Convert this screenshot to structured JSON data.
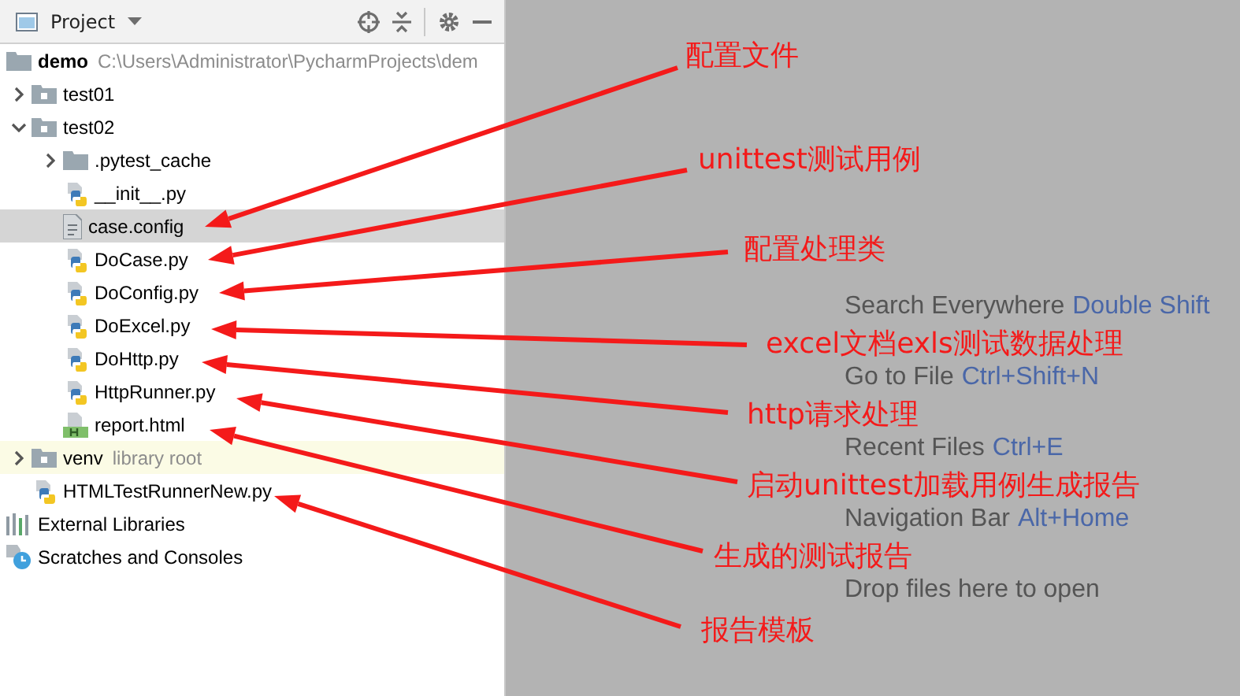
{
  "panel": {
    "title": "Project"
  },
  "tree": [
    {
      "label": "demo",
      "kind": "root",
      "path": "C:\\Users\\Administrator\\PycharmProjects\\dem",
      "selected": false,
      "children": [
        {
          "label": "test01",
          "kind": "module-folder",
          "selected": false,
          "expanded": false
        },
        {
          "label": "test02",
          "kind": "module-folder",
          "selected": false,
          "expanded": true,
          "children": [
            {
              "label": ".pytest_cache",
              "kind": "folder",
              "selected": false,
              "expanded": false
            },
            {
              "label": "__init__.py",
              "kind": "python",
              "selected": false
            },
            {
              "label": "case.config",
              "kind": "text-file",
              "selected": true
            },
            {
              "label": "DoCase.py",
              "kind": "python",
              "selected": false
            },
            {
              "label": "DoConfig.py",
              "kind": "python",
              "selected": false
            },
            {
              "label": "DoExcel.py",
              "kind": "python",
              "selected": false
            },
            {
              "label": "DoHttp.py",
              "kind": "python",
              "selected": false
            },
            {
              "label": "HttpRunner.py",
              "kind": "python",
              "selected": false
            },
            {
              "label": "report.html",
              "kind": "html",
              "selected": false
            }
          ]
        },
        {
          "label": "venv",
          "kind": "module-folder",
          "note": "library root",
          "selected": false,
          "expanded": false
        },
        {
          "label": "HTMLTestRunnerNew.py",
          "kind": "python",
          "selected": false
        }
      ]
    },
    {
      "label": "External Libraries",
      "kind": "libraries",
      "selected": false
    },
    {
      "label": "Scratches and Consoles",
      "kind": "scratches",
      "selected": false
    }
  ],
  "editor_hints": [
    {
      "text": "Search Everywhere",
      "shortcut": "Double Shift"
    },
    {
      "text": "Go to File",
      "shortcut": "Ctrl+Shift+N"
    },
    {
      "text": "Recent Files",
      "shortcut": "Ctrl+E"
    },
    {
      "text": "Navigation Bar",
      "shortcut": "Alt+Home"
    },
    {
      "text": "Drop files here to open"
    }
  ],
  "annotations": [
    {
      "text": "配置文件"
    },
    {
      "text": "unittest测试用例"
    },
    {
      "text": "配置处理类"
    },
    {
      "text": "excel文档exls测试数据处理"
    },
    {
      "text": "http请求处理"
    },
    {
      "text": "启动unittest加载用例生成报告"
    },
    {
      "text": "生成的测试报告"
    },
    {
      "text": "报告模板"
    }
  ]
}
